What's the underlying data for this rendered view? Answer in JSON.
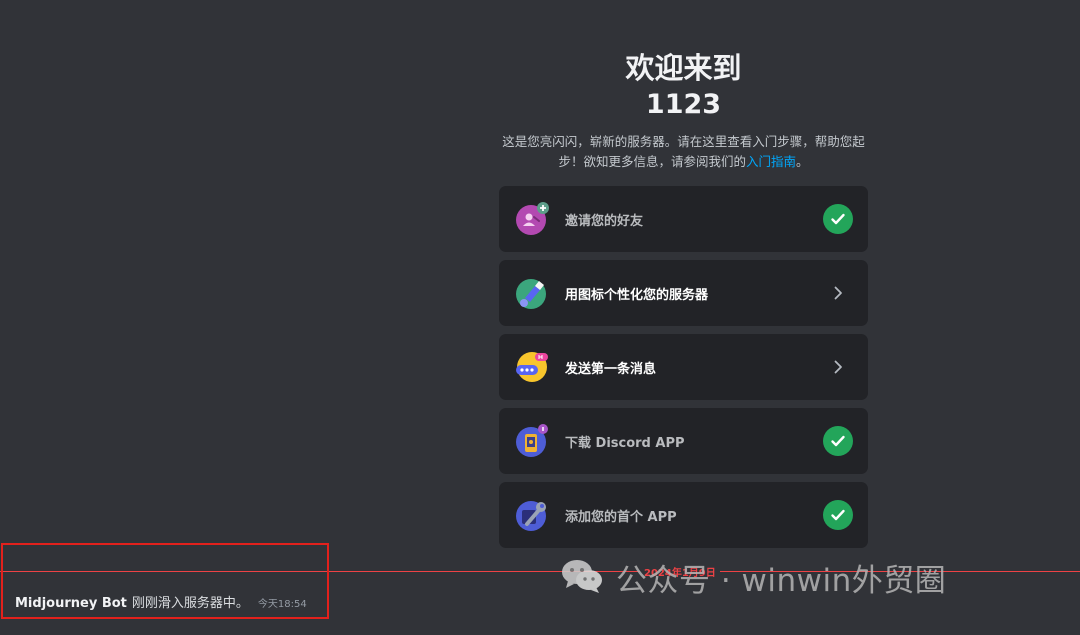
{
  "welcome": {
    "title": "欢迎来到",
    "server_name": "1123",
    "desc_text": "这是您亮闪闪，崭新的服务器。请在这里查看入门步骤，帮助您起步！欲知更多信息，请参阅我们的",
    "guide_link": "入门指南",
    "desc_end": "。"
  },
  "checklist": [
    {
      "label": "邀请您的好友",
      "status": "done",
      "icon": "invite-friends-icon"
    },
    {
      "label": "用图标个性化您的服务器",
      "status": "todo",
      "icon": "paintbrush-icon"
    },
    {
      "label": "发送第一条消息",
      "status": "todo",
      "icon": "chat-bubble-icon"
    },
    {
      "label": "下载 Discord APP",
      "status": "done",
      "icon": "mobile-app-icon"
    },
    {
      "label": "添加您的首个 APP",
      "status": "done",
      "icon": "wrench-icon"
    }
  ],
  "divider": {
    "date": "2024年1月9日",
    "color": "#ed4245"
  },
  "message": {
    "user": "Midjourney Bot",
    "text": "刚刚滑入服务器中。",
    "time": "今天18:54"
  },
  "watermark": {
    "text": "公众号 · winwin外贸圈",
    "icon": "wechat-icon"
  },
  "colors": {
    "background": "#313338",
    "card": "#222327",
    "check": "#23a55a",
    "link": "#00a8fc",
    "highlight": "#e2211c"
  }
}
